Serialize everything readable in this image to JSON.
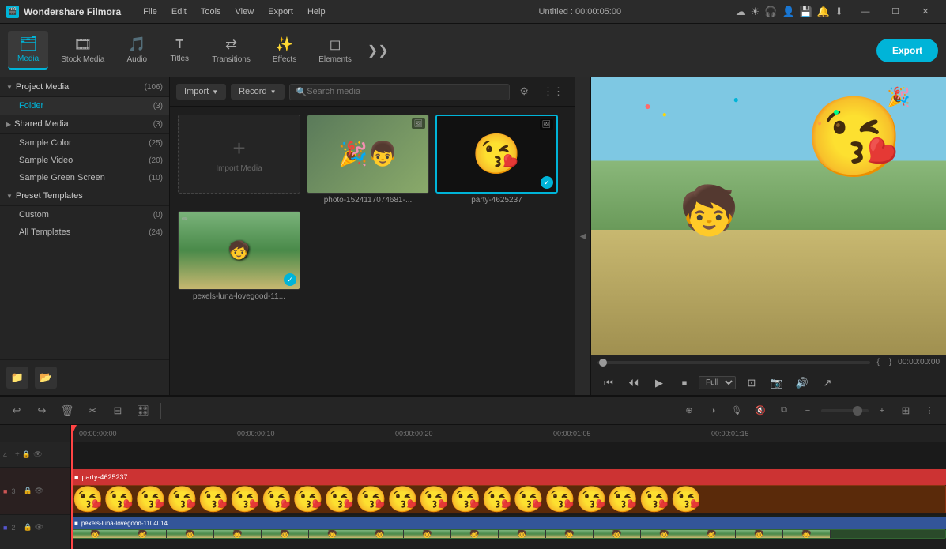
{
  "app": {
    "name": "Wondershare Filmora",
    "title": "Untitled : 00:00:05:00",
    "icon": "🎬"
  },
  "menu": {
    "items": [
      "File",
      "Edit",
      "Tools",
      "View",
      "Export",
      "Help"
    ]
  },
  "window_controls": {
    "minimize": "—",
    "maximize": "☐",
    "close": "✕"
  },
  "toolbar": {
    "items": [
      {
        "id": "media",
        "icon": "🗂",
        "label": "Media",
        "active": true
      },
      {
        "id": "stock",
        "icon": "🎞",
        "label": "Stock Media",
        "active": false
      },
      {
        "id": "audio",
        "icon": "🎵",
        "label": "Audio",
        "active": false
      },
      {
        "id": "titles",
        "icon": "T",
        "label": "Titles",
        "active": false
      },
      {
        "id": "transitions",
        "icon": "⇄",
        "label": "Transitions",
        "active": false
      },
      {
        "id": "effects",
        "icon": "✨",
        "label": "Effects",
        "active": false
      },
      {
        "id": "elements",
        "icon": "◻",
        "label": "Elements",
        "active": false
      }
    ],
    "export_label": "Export"
  },
  "media_panel": {
    "import_label": "Import",
    "record_label": "Record",
    "search_placeholder": "Search media",
    "import_media_label": "Import Media",
    "items": [
      {
        "id": "photo",
        "name": "photo-1524117074681-...",
        "type": "image",
        "selected": false
      },
      {
        "id": "party",
        "name": "party-4625237",
        "type": "image",
        "selected": true
      },
      {
        "id": "pexels",
        "name": "pexels-luna-lovegood-11...",
        "type": "video",
        "selected": false
      }
    ]
  },
  "sidebar": {
    "project_media": {
      "label": "Project Media",
      "count": "(106)"
    },
    "folder": {
      "label": "Folder",
      "count": "(3)"
    },
    "shared_media": {
      "label": "Shared Media",
      "count": "(3)"
    },
    "sample_color": {
      "label": "Sample Color",
      "count": "(25)"
    },
    "sample_video": {
      "label": "Sample Video",
      "count": "(20)"
    },
    "sample_green_screen": {
      "label": "Sample Green Screen",
      "count": "(10)"
    },
    "preset_templates": {
      "label": "Preset Templates",
      "count": ""
    },
    "custom": {
      "label": "Custom",
      "count": "(0)"
    },
    "all_templates": {
      "label": "All Templates",
      "count": "(24)"
    }
  },
  "preview": {
    "timecode": "00:00:00:00",
    "total_time": "00:00:05:00",
    "quality": "Full",
    "in_point": "{",
    "out_point": "}"
  },
  "timeline": {
    "timecodes": [
      "00:00:00:00",
      "00:00:00:10",
      "00:00:00:20",
      "00:00:01:05",
      "00:00:01:15"
    ],
    "tracks": [
      {
        "num": "4",
        "type": "video",
        "label": ""
      },
      {
        "num": "3",
        "type": "video",
        "label": "party-4625237",
        "color": "#8B4513"
      },
      {
        "num": "2",
        "type": "video",
        "label": "pexels-luna-lovegood-1104014",
        "color": "#556B2F"
      }
    ]
  }
}
